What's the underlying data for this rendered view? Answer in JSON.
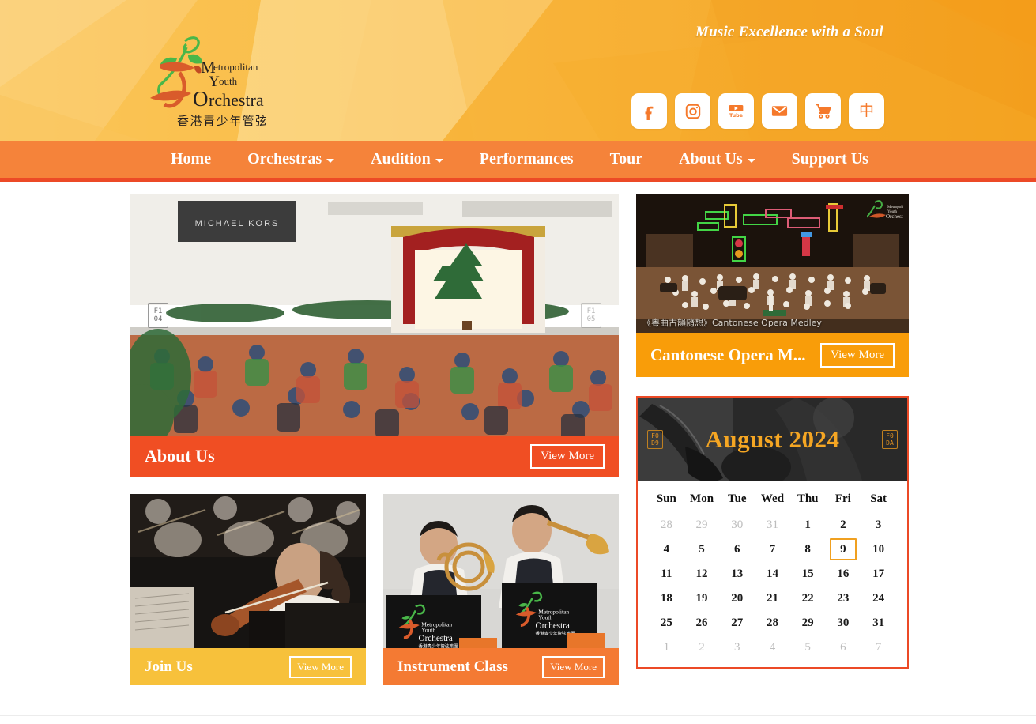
{
  "header": {
    "logo": {
      "name_line1": "Metropolitan",
      "name_line2": "Youth",
      "name_line3": "Orchestra",
      "name_chinese": "香港青少年管弦樂團",
      "mark_initials": "My"
    },
    "tagline": "Music Excellence with a Soul",
    "social": [
      {
        "name": "facebook-icon",
        "label": "Facebook"
      },
      {
        "name": "instagram-icon",
        "label": "Instagram"
      },
      {
        "name": "youtube-icon",
        "label": "YouTube"
      },
      {
        "name": "email-icon",
        "label": "Email"
      },
      {
        "name": "cart-icon",
        "label": "Shopping Cart"
      },
      {
        "name": "language-icon",
        "label": "中"
      }
    ],
    "colors": {
      "header_bg": "#F5A623",
      "header_light": "#FBD37A",
      "nav_bg": "#F5833A",
      "nav_border": "#EC4A26"
    }
  },
  "nav": {
    "items": [
      {
        "label": "Home",
        "has_dropdown": false
      },
      {
        "label": "Orchestras",
        "has_dropdown": true
      },
      {
        "label": "Audition",
        "has_dropdown": true
      },
      {
        "label": "Performances",
        "has_dropdown": false
      },
      {
        "label": "Tour",
        "has_dropdown": false
      },
      {
        "label": "About Us",
        "has_dropdown": true
      },
      {
        "label": "Support Us",
        "has_dropdown": false
      }
    ]
  },
  "main": {
    "hero": {
      "title": "About Us",
      "button": "View More",
      "bar_color": "#F04E23",
      "image_alt": "Orchestra performance in a shopping mall at Christmas",
      "prev_arrow_code": "F1\n04",
      "next_arrow_code": "F1\n05"
    },
    "cards": [
      {
        "title": "Join Us",
        "button": "View More",
        "bar_color": "#F7C13B",
        "image_alt": "Young girl playing violin in orchestra"
      },
      {
        "title": "Instrument Class",
        "button": "View More",
        "bar_color": "#F47A33",
        "image_alt": "Two boys playing french horn and trumpet"
      }
    ],
    "video": {
      "title": "Cantonese Opera M...",
      "button": "View More",
      "bar_color": "#F99D09",
      "overlay_caption": "《粵曲古韻隨想》Cantonese Opera Medley",
      "image_alt": "Full orchestra on stage with neon sign backdrop"
    },
    "calendar": {
      "month_label": "August 2024",
      "prev_code": "F0\nD9",
      "next_code": "F0\nDA",
      "weekdays": [
        "Sun",
        "Mon",
        "Tue",
        "Wed",
        "Thu",
        "Fri",
        "Sat"
      ],
      "today": 9,
      "accent_color": "#F0A020",
      "border_color": "#EC4A26",
      "weeks": [
        [
          {
            "d": "28",
            "muted": true
          },
          {
            "d": "29",
            "muted": true
          },
          {
            "d": "30",
            "muted": true
          },
          {
            "d": "31",
            "muted": true
          },
          {
            "d": "1",
            "muted": false
          },
          {
            "d": "2",
            "muted": false
          },
          {
            "d": "3",
            "muted": false
          }
        ],
        [
          {
            "d": "4",
            "muted": false
          },
          {
            "d": "5",
            "muted": false
          },
          {
            "d": "6",
            "muted": false
          },
          {
            "d": "7",
            "muted": false
          },
          {
            "d": "8",
            "muted": false
          },
          {
            "d": "9",
            "muted": false,
            "today": true
          },
          {
            "d": "10",
            "muted": false
          }
        ],
        [
          {
            "d": "11",
            "muted": false
          },
          {
            "d": "12",
            "muted": false
          },
          {
            "d": "13",
            "muted": false
          },
          {
            "d": "14",
            "muted": false
          },
          {
            "d": "15",
            "muted": false
          },
          {
            "d": "16",
            "muted": false
          },
          {
            "d": "17",
            "muted": false
          }
        ],
        [
          {
            "d": "18",
            "muted": false
          },
          {
            "d": "19",
            "muted": false
          },
          {
            "d": "20",
            "muted": false
          },
          {
            "d": "21",
            "muted": false
          },
          {
            "d": "22",
            "muted": false
          },
          {
            "d": "23",
            "muted": false
          },
          {
            "d": "24",
            "muted": false
          }
        ],
        [
          {
            "d": "25",
            "muted": false
          },
          {
            "d": "26",
            "muted": false
          },
          {
            "d": "27",
            "muted": false
          },
          {
            "d": "28",
            "muted": false
          },
          {
            "d": "29",
            "muted": false
          },
          {
            "d": "30",
            "muted": false
          },
          {
            "d": "31",
            "muted": false
          }
        ],
        [
          {
            "d": "1",
            "muted": true
          },
          {
            "d": "2",
            "muted": true
          },
          {
            "d": "3",
            "muted": true
          },
          {
            "d": "4",
            "muted": true
          },
          {
            "d": "5",
            "muted": true
          },
          {
            "d": "6",
            "muted": true
          },
          {
            "d": "7",
            "muted": true
          }
        ]
      ]
    }
  }
}
